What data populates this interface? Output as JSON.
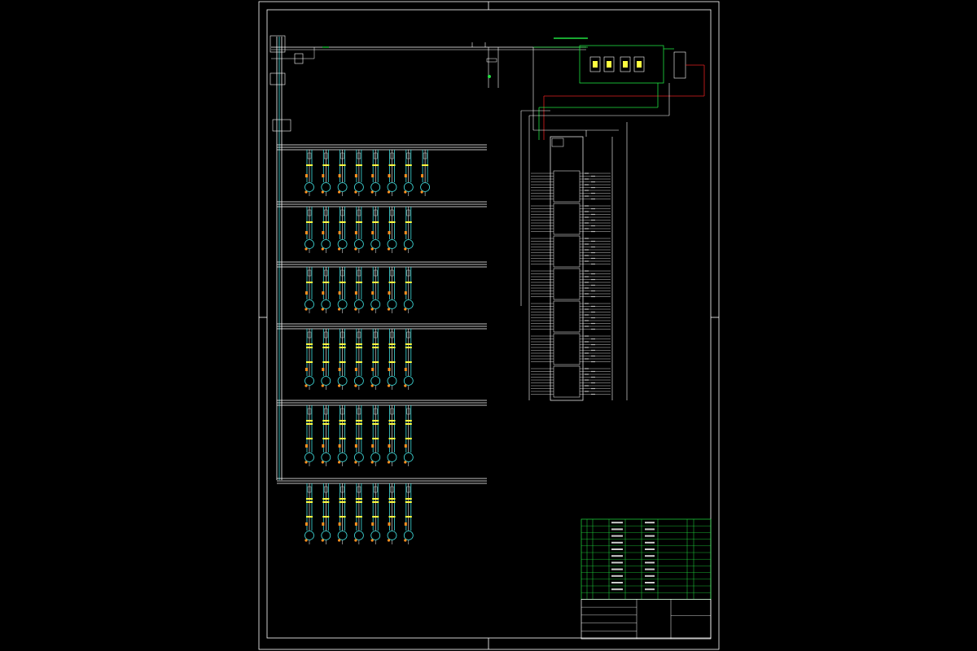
{
  "drawing": {
    "background": "#000000",
    "frame_color": "#ffffff",
    "bus_color": "#ffffff",
    "cable_color": "#40e0e0",
    "device_color": "#ffff40",
    "terminal_color": "#ff9020",
    "green_color": "#20e040",
    "red_color": "#e02020"
  },
  "motor_rows": [
    {
      "type": "single",
      "count": 8
    },
    {
      "type": "single",
      "count": 7
    },
    {
      "type": "single",
      "count": 7
    },
    {
      "type": "double",
      "count": 7
    },
    {
      "type": "double",
      "count": 7
    },
    {
      "type": "double",
      "count": 7
    }
  ],
  "plc": {
    "modules": 7
  },
  "title_block": {
    "parts_rows": 12
  }
}
